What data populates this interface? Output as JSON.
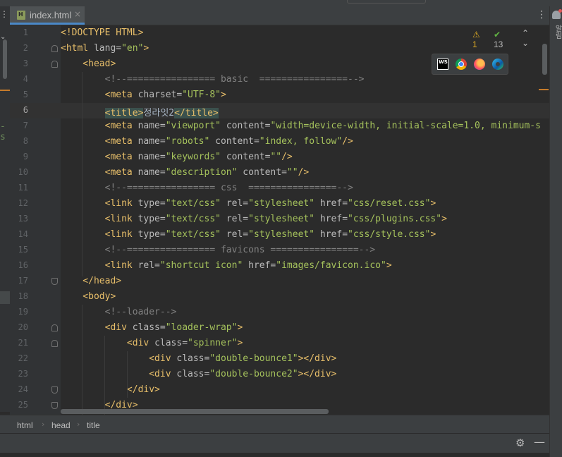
{
  "tab": {
    "file_name": "index.html",
    "close_glyph": "×"
  },
  "inspections": {
    "warnings": "1",
    "checks": "13",
    "up": "⌃",
    "down": "⌄"
  },
  "browsers": [
    "webstorm-icon",
    "chrome-icon",
    "firefox-icon",
    "edge-icon"
  ],
  "right_sidebar": {
    "label": "알림"
  },
  "left_edge_text": "-s",
  "breadcrumb": [
    "html",
    "head",
    "title"
  ],
  "gutter": {
    "line_numbers": [
      "1",
      "2",
      "3",
      "4",
      "5",
      "6",
      "7",
      "8",
      "9",
      "10",
      "11",
      "12",
      "13",
      "14",
      "15",
      "16",
      "17",
      "18",
      "19",
      "20",
      "21",
      "22",
      "23",
      "24",
      "25"
    ],
    "current_line": "6"
  },
  "code_lines": [
    [
      {
        "t": "<!DOCTYPE HTML>",
        "c": "doctype"
      }
    ],
    [
      {
        "t": "<html ",
        "c": "tag"
      },
      {
        "t": "lang=",
        "c": "attr"
      },
      {
        "t": "\"en\"",
        "c": "val"
      },
      {
        "t": ">",
        "c": "tag"
      }
    ],
    [
      {
        "t": "    <head>",
        "c": "tag"
      }
    ],
    [
      {
        "t": "        <!--================ basic  ================-->",
        "c": "cmt"
      }
    ],
    [
      {
        "t": "        <meta ",
        "c": "tag"
      },
      {
        "t": "charset=",
        "c": "attr"
      },
      {
        "t": "\"UTF-8\"",
        "c": "val"
      },
      {
        "t": ">",
        "c": "tag"
      }
    ],
    [
      {
        "t": "        ",
        "c": "txt"
      },
      {
        "t": "<title>",
        "c": "tag hl"
      },
      {
        "t": "정라잇2",
        "c": "txt"
      },
      {
        "t": "</title>",
        "c": "tag hl"
      }
    ],
    [
      {
        "t": "        <meta ",
        "c": "tag"
      },
      {
        "t": "name=",
        "c": "attr"
      },
      {
        "t": "\"viewport\"",
        "c": "val"
      },
      {
        "t": " content=",
        "c": "attr"
      },
      {
        "t": "\"width=device-width, initial-scale=1.0, minimum-s",
        "c": "val"
      }
    ],
    [
      {
        "t": "        <meta ",
        "c": "tag"
      },
      {
        "t": "name=",
        "c": "attr"
      },
      {
        "t": "\"robots\"",
        "c": "val"
      },
      {
        "t": " content=",
        "c": "attr"
      },
      {
        "t": "\"index, follow\"",
        "c": "val"
      },
      {
        "t": "/>",
        "c": "tag"
      }
    ],
    [
      {
        "t": "        <meta ",
        "c": "tag"
      },
      {
        "t": "name=",
        "c": "attr"
      },
      {
        "t": "\"keywords\"",
        "c": "val"
      },
      {
        "t": " content=",
        "c": "attr"
      },
      {
        "t": "\"\"",
        "c": "val"
      },
      {
        "t": "/>",
        "c": "tag"
      }
    ],
    [
      {
        "t": "        <meta ",
        "c": "tag"
      },
      {
        "t": "name=",
        "c": "attr"
      },
      {
        "t": "\"description\"",
        "c": "val"
      },
      {
        "t": " content=",
        "c": "attr"
      },
      {
        "t": "\"\"",
        "c": "val"
      },
      {
        "t": "/>",
        "c": "tag"
      }
    ],
    [
      {
        "t": "        <!--================ css  ================-->",
        "c": "cmt"
      }
    ],
    [
      {
        "t": "        <link ",
        "c": "tag"
      },
      {
        "t": "type=",
        "c": "attr"
      },
      {
        "t": "\"text/css\"",
        "c": "val"
      },
      {
        "t": " rel=",
        "c": "attr"
      },
      {
        "t": "\"stylesheet\"",
        "c": "val"
      },
      {
        "t": " href=",
        "c": "attr"
      },
      {
        "t": "\"css/reset.css\"",
        "c": "val"
      },
      {
        "t": ">",
        "c": "tag"
      }
    ],
    [
      {
        "t": "        <link ",
        "c": "tag"
      },
      {
        "t": "type=",
        "c": "attr"
      },
      {
        "t": "\"text/css\"",
        "c": "val"
      },
      {
        "t": " rel=",
        "c": "attr"
      },
      {
        "t": "\"stylesheet\"",
        "c": "val"
      },
      {
        "t": " href=",
        "c": "attr"
      },
      {
        "t": "\"css/plugins.css\"",
        "c": "val"
      },
      {
        "t": ">",
        "c": "tag"
      }
    ],
    [
      {
        "t": "        <link ",
        "c": "tag"
      },
      {
        "t": "type=",
        "c": "attr"
      },
      {
        "t": "\"text/css\"",
        "c": "val"
      },
      {
        "t": " rel=",
        "c": "attr"
      },
      {
        "t": "\"stylesheet\"",
        "c": "val"
      },
      {
        "t": " href=",
        "c": "attr"
      },
      {
        "t": "\"css/style.css\"",
        "c": "val"
      },
      {
        "t": ">",
        "c": "tag"
      }
    ],
    [
      {
        "t": "        <!--================ favicons ================-->",
        "c": "cmt"
      }
    ],
    [
      {
        "t": "        <link ",
        "c": "tag"
      },
      {
        "t": "rel=",
        "c": "attr"
      },
      {
        "t": "\"shortcut icon\"",
        "c": "val"
      },
      {
        "t": " href=",
        "c": "attr"
      },
      {
        "t": "\"images/favicon.ico\"",
        "c": "val"
      },
      {
        "t": ">",
        "c": "tag"
      }
    ],
    [
      {
        "t": "    </head>",
        "c": "tag"
      }
    ],
    [
      {
        "t": "    <body>",
        "c": "tag"
      }
    ],
    [
      {
        "t": "        <!--loader-->",
        "c": "cmt"
      }
    ],
    [
      {
        "t": "        <div ",
        "c": "tag"
      },
      {
        "t": "class=",
        "c": "attr"
      },
      {
        "t": "\"loader-wrap\"",
        "c": "val"
      },
      {
        "t": ">",
        "c": "tag"
      }
    ],
    [
      {
        "t": "            <div ",
        "c": "tag"
      },
      {
        "t": "class=",
        "c": "attr"
      },
      {
        "t": "\"spinner\"",
        "c": "val"
      },
      {
        "t": ">",
        "c": "tag"
      }
    ],
    [
      {
        "t": "                <div ",
        "c": "tag"
      },
      {
        "t": "class=",
        "c": "attr"
      },
      {
        "t": "\"double-bounce1\"",
        "c": "val"
      },
      {
        "t": "></div>",
        "c": "tag"
      }
    ],
    [
      {
        "t": "                <div ",
        "c": "tag"
      },
      {
        "t": "class=",
        "c": "attr"
      },
      {
        "t": "\"double-bounce2\"",
        "c": "val"
      },
      {
        "t": "></div>",
        "c": "tag"
      }
    ],
    [
      {
        "t": "            </div>",
        "c": "tag"
      }
    ],
    [
      {
        "t": "        </div>",
        "c": "tag"
      }
    ]
  ]
}
